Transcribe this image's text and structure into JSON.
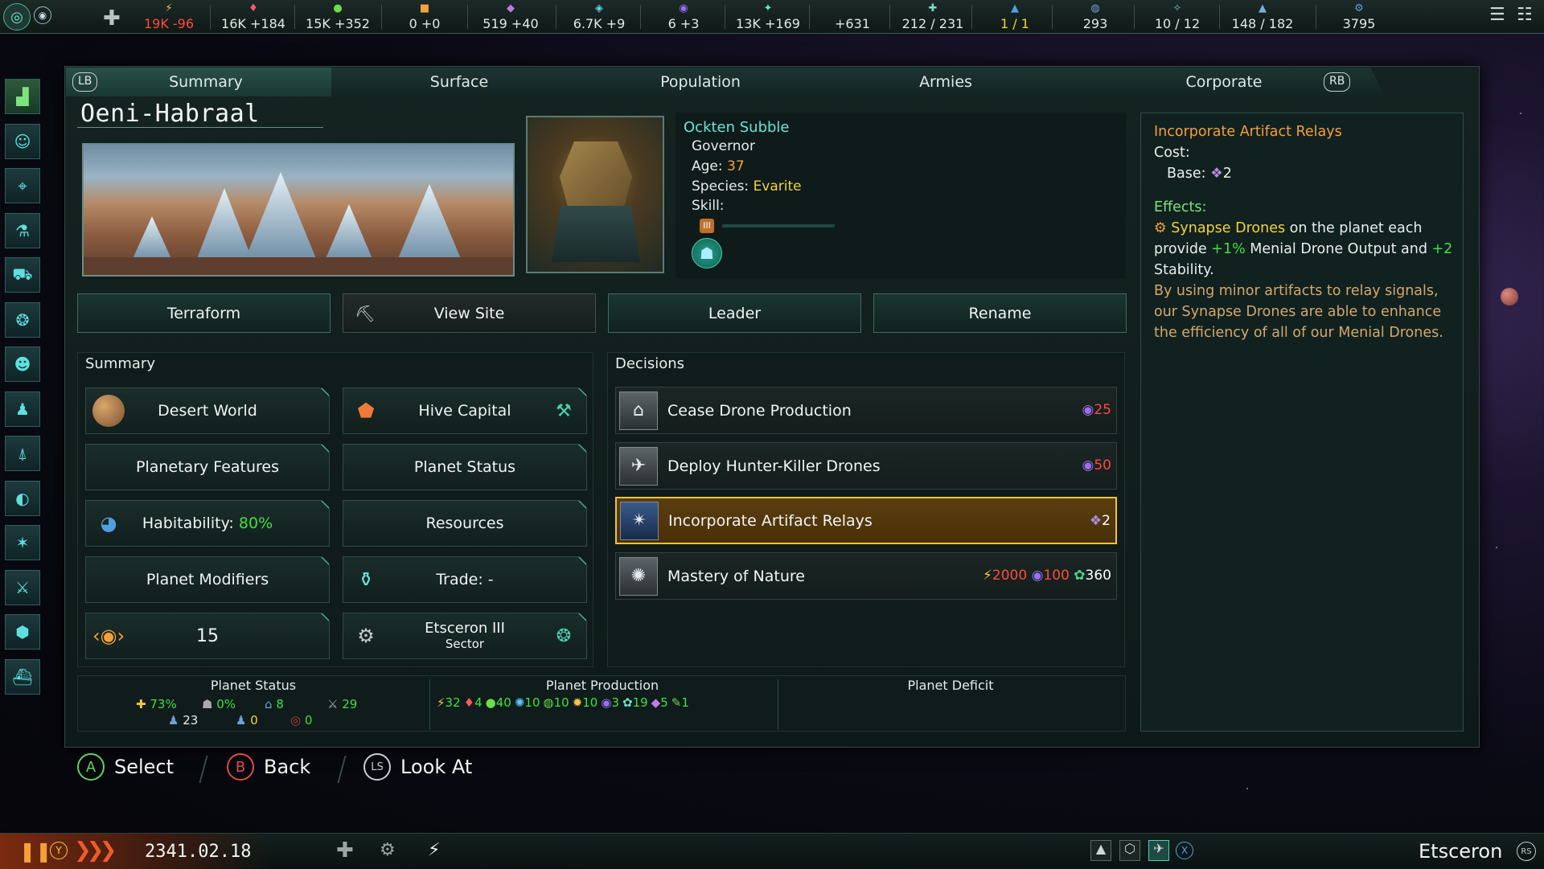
{
  "topbar": {
    "resources": [
      {
        "icon": "energy-icon",
        "glyph": "⚡",
        "color": "#f5c542",
        "value": "19K -96",
        "value_color": "#ff4a3a"
      },
      {
        "icon": "minerals-icon",
        "glyph": "♦",
        "color": "#ff5a5a",
        "value": "16K +184"
      },
      {
        "icon": "food-icon",
        "glyph": "●",
        "color": "#6fdc4a",
        "value": "15K +352"
      },
      {
        "icon": "consumer-goods-icon",
        "glyph": "■",
        "color": "#f2a33a",
        "value": "0 +0"
      },
      {
        "icon": "alloys-icon",
        "glyph": "◆",
        "color": "#c07ae6",
        "value": "519 +40"
      },
      {
        "icon": "research-icon",
        "glyph": "◈",
        "color": "#5ed8f0",
        "value": "6.7K +9"
      },
      {
        "icon": "unity-icon",
        "glyph": "◉",
        "color": "#9a6ff0",
        "value": "6 +3"
      },
      {
        "icon": "influence-icon",
        "glyph": "✦",
        "color": "#6fe3c8",
        "value": "13K +169"
      },
      {
        "icon": "amenities-icon",
        "glyph": "",
        "color": "#6fe3c8",
        "value": "+631"
      },
      {
        "icon": "empire-size-icon",
        "glyph": "✚",
        "color": "#7ae0c8",
        "value": "212 / 231"
      },
      {
        "icon": "leader-cap-icon",
        "glyph": "▲",
        "color": "#4fa0e0",
        "value": "1 / 1",
        "value_color": "#f2d23a"
      },
      {
        "icon": "pops-icon",
        "glyph": "◍",
        "color": "#6fa0d8",
        "value": "293"
      },
      {
        "icon": "starbase-icon",
        "glyph": "✧",
        "color": "#6fc0c8",
        "value": "10 / 12"
      },
      {
        "icon": "fleet-icon",
        "glyph": "▲",
        "color": "#7ab0d8",
        "value": "148 / 182"
      },
      {
        "icon": "stability-icon",
        "glyph": "⚙",
        "color": "#5a9ae0",
        "value": "3795"
      }
    ]
  },
  "tabs": {
    "lb": "LB",
    "rb": "RB",
    "items": [
      "Summary",
      "Surface",
      "Population",
      "Armies",
      "Corporate"
    ],
    "active": "Summary"
  },
  "planet": {
    "name": "Oeni-Habraal"
  },
  "leader": {
    "name": "Ockten Subble",
    "role": "Governor",
    "age_label": "Age:",
    "age": "37",
    "species_label": "Species:",
    "species": "Evarite",
    "skill_label": "Skill:",
    "skill_progress": 0.0
  },
  "actions": {
    "terraform": "Terraform",
    "view_site": "View Site",
    "leader": "Leader",
    "rename": "Rename"
  },
  "summary": {
    "title": "Summary",
    "world_type": "Desert World",
    "designation": "Hive Capital",
    "features": "Planetary Features",
    "status": "Planet Status",
    "habitability_label": "Habitability:",
    "habitability_value": "80%",
    "resources": "Resources",
    "modifiers": "Planet Modifiers",
    "trade": "Trade: -",
    "size": "15",
    "sector_name": "Etsceron III",
    "sector_label": "Sector"
  },
  "decisions": {
    "title": "Decisions",
    "items": [
      {
        "label": "Cease Drone Production",
        "cost": "25",
        "cost_color": "#ff4a3a",
        "cost_icon": "unity-icon"
      },
      {
        "label": "Deploy Hunter-Killer Drones",
        "cost": "50",
        "cost_color": "#ff4a3a",
        "cost_icon": "unity-icon"
      },
      {
        "label": "Incorporate Artifact Relays",
        "cost": "2",
        "cost_color": "#ffffff",
        "cost_icon": "artifact-icon"
      },
      {
        "label": "Mastery of Nature",
        "cost_energy": "2000",
        "cost_unity": "100",
        "cost_influence": "360"
      }
    ]
  },
  "stats": {
    "status_title": "Planet Status",
    "stability": "73%",
    "crime": "0%",
    "housing": "8",
    "defense": "29",
    "pops": "23",
    "unemployed": "0",
    "devastation": "0",
    "production_title": "Planet Production",
    "production": [
      {
        "icon": "energy-icon",
        "glyph": "⚡",
        "color": "#f5c542",
        "value": "32"
      },
      {
        "icon": "minerals-icon",
        "glyph": "♦",
        "color": "#ff5a5a",
        "value": "4"
      },
      {
        "icon": "food-icon",
        "glyph": "●",
        "color": "#6fdc4a",
        "value": "40"
      },
      {
        "icon": "physics-icon",
        "glyph": "✺",
        "color": "#5ec8f0",
        "value": "10"
      },
      {
        "icon": "society-icon",
        "glyph": "◍",
        "color": "#6fdc4a",
        "value": "10"
      },
      {
        "icon": "engineering-icon",
        "glyph": "✹",
        "color": "#f5c542",
        "value": "10"
      },
      {
        "icon": "unity-icon",
        "glyph": "◉",
        "color": "#9a6ff0",
        "value": "3"
      },
      {
        "icon": "influence-icon",
        "glyph": "✿",
        "color": "#6fe3c8",
        "value": "19"
      },
      {
        "icon": "alloys-icon",
        "glyph": "◆",
        "color": "#c07ae6",
        "value": "5"
      },
      {
        "icon": "trade-icon",
        "glyph": "✎",
        "color": "#6fdc4a",
        "value": "1"
      }
    ],
    "deficit_title": "Planet Deficit"
  },
  "tooltip": {
    "title": "Incorporate Artifact Relays",
    "cost_label": "Cost:",
    "base_label": "Base:",
    "base_value": "2",
    "effects_label": "Effects:",
    "effect_a": "Synapse Drones",
    "effect_b": " on the planet each provide ",
    "effect_c": "+1%",
    "effect_d": " Menial Drone Output and ",
    "effect_e": "+2",
    "effect_f": " Stability.",
    "flavor": "By using minor artifacts to relay signals, our Synapse Drones are able to enhance the efficiency of all of our Menial Drones."
  },
  "controls": {
    "a": "A",
    "select": "Select",
    "b": "B",
    "back": "Back",
    "ls": "LS",
    "look_at": "Look At"
  },
  "bottombar": {
    "date": "2341.02.18",
    "location": "Etsceron",
    "y": "Y",
    "x": "X",
    "rs": "RS"
  }
}
